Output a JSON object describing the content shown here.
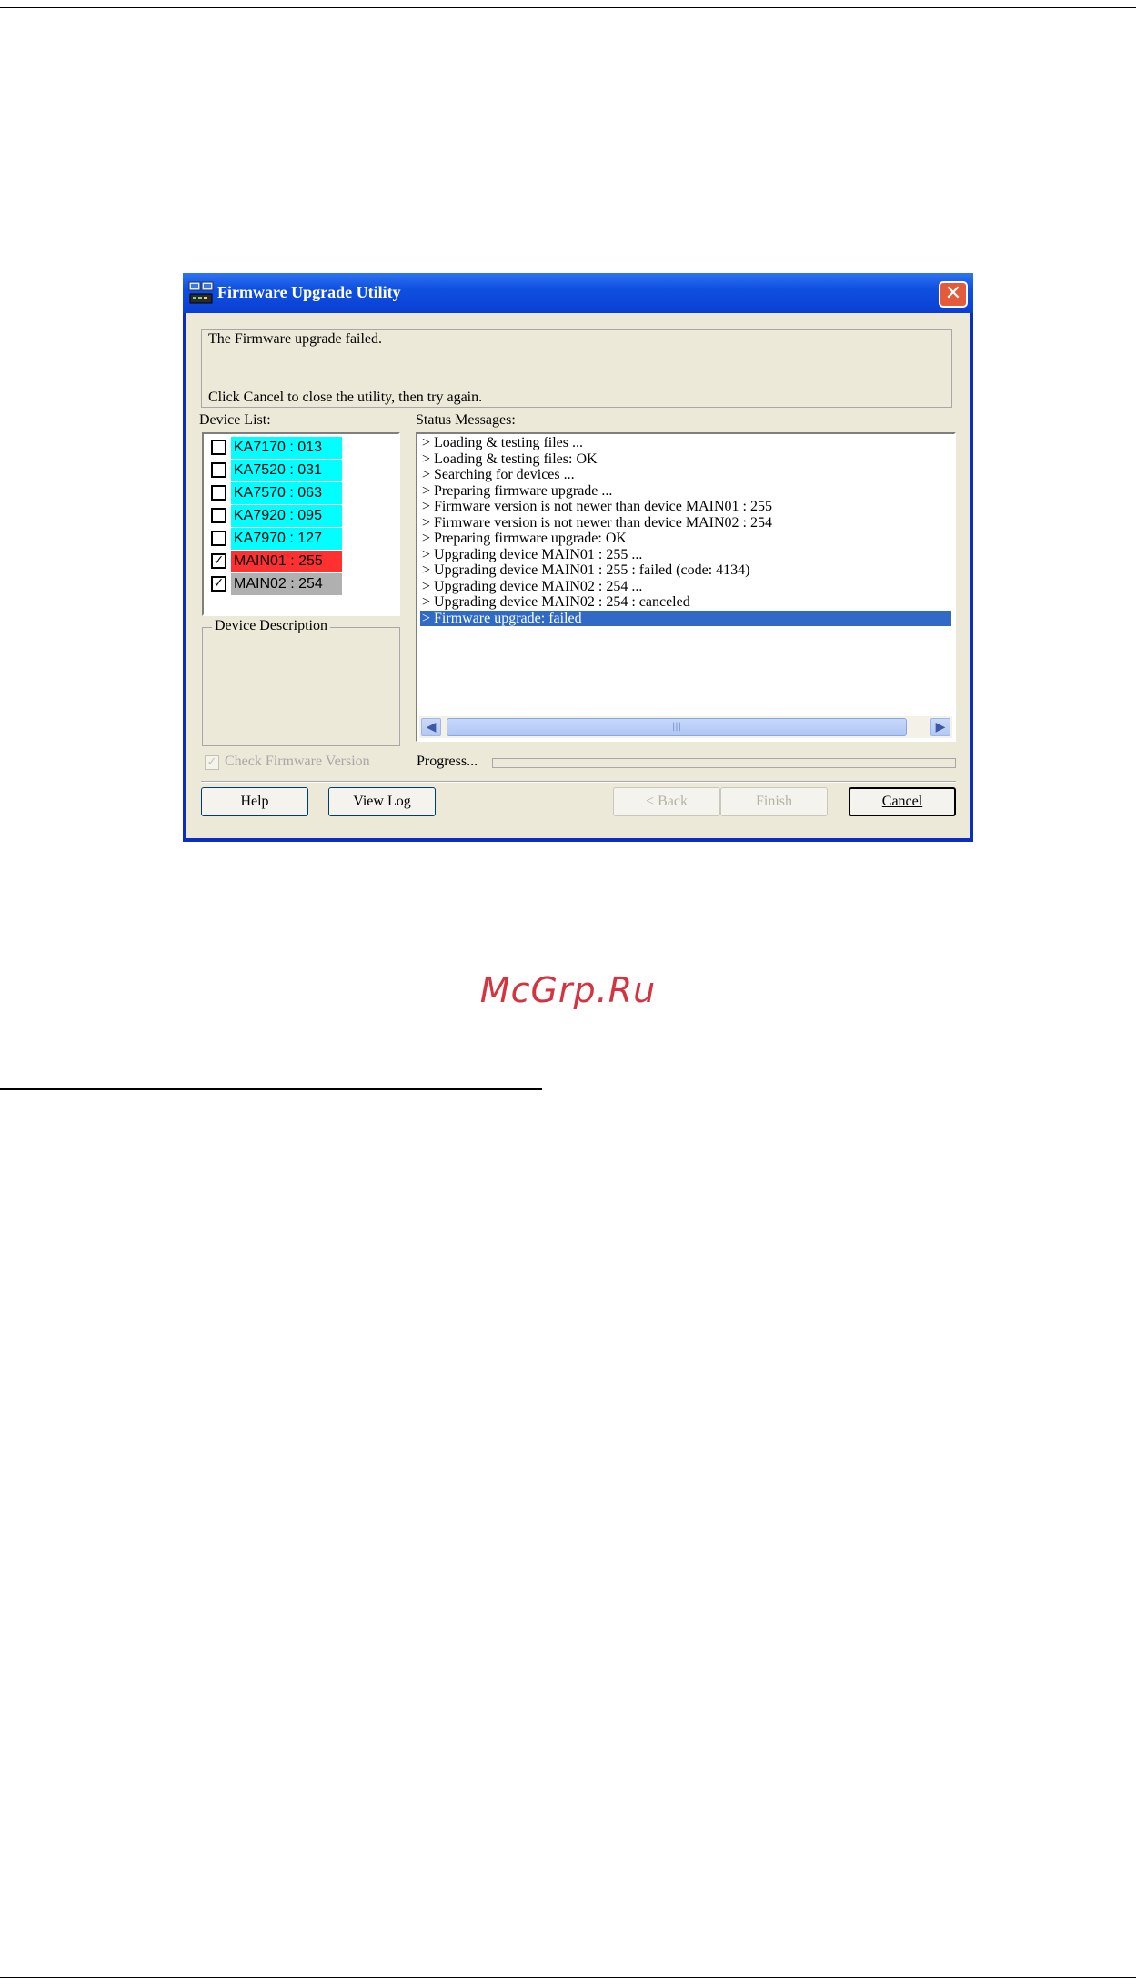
{
  "window": {
    "title": "Firmware Upgrade Utility",
    "close_symbol": "✕"
  },
  "message": {
    "line1": "The Firmware upgrade failed.",
    "line2": "Click Cancel to close the utility, then try again."
  },
  "device_list": {
    "label": "Device List:",
    "items": [
      {
        "name": "KA7170 : 013",
        "checked": false,
        "bg": "#00ffff"
      },
      {
        "name": "KA7520 : 031",
        "checked": false,
        "bg": "#00ffff"
      },
      {
        "name": "KA7570 : 063",
        "checked": false,
        "bg": "#00ffff"
      },
      {
        "name": "KA7920 : 095",
        "checked": false,
        "bg": "#00ffff"
      },
      {
        "name": "KA7970 : 127",
        "checked": false,
        "bg": "#00ffff"
      },
      {
        "name": "MAIN01 : 255",
        "checked": true,
        "bg": "#ff3030"
      },
      {
        "name": "MAIN02 : 254",
        "checked": true,
        "bg": "#b0b0b0"
      }
    ]
  },
  "device_description": {
    "label": "Device Description"
  },
  "status": {
    "label": "Status Messages:",
    "lines": [
      "> Loading & testing files ...",
      "> Loading & testing files: OK",
      "> Searching for devices ...",
      "> Preparing firmware upgrade ...",
      "> Firmware version is not newer than device MAIN01 : 255",
      "> Firmware version is not newer than device MAIN02 : 254",
      "> Preparing firmware upgrade: OK",
      "> Upgrading device MAIN01 : 255 ...",
      "> Upgrading device MAIN01 : 255 : failed (code: 4134)",
      "> Upgrading device MAIN02 : 254 ...",
      "> Upgrading device MAIN02 : 254 : canceled",
      "> Firmware upgrade: failed"
    ],
    "selected_index": 11
  },
  "options": {
    "check_firmware_label": "Check Firmware Version",
    "check_firmware_checked": true,
    "progress_label": "Progress...",
    "progress_value": 0
  },
  "buttons": {
    "help": "Help",
    "view_log": "View Log",
    "back": "< Back",
    "finish": "Finish",
    "cancel": "Cancel"
  },
  "watermark": "McGrp.Ru",
  "colors": {
    "title_bar": "#0a3fd4",
    "selection": "#316ac5",
    "dialog_bg": "#ece9d8",
    "watermark": "#d4343f"
  }
}
